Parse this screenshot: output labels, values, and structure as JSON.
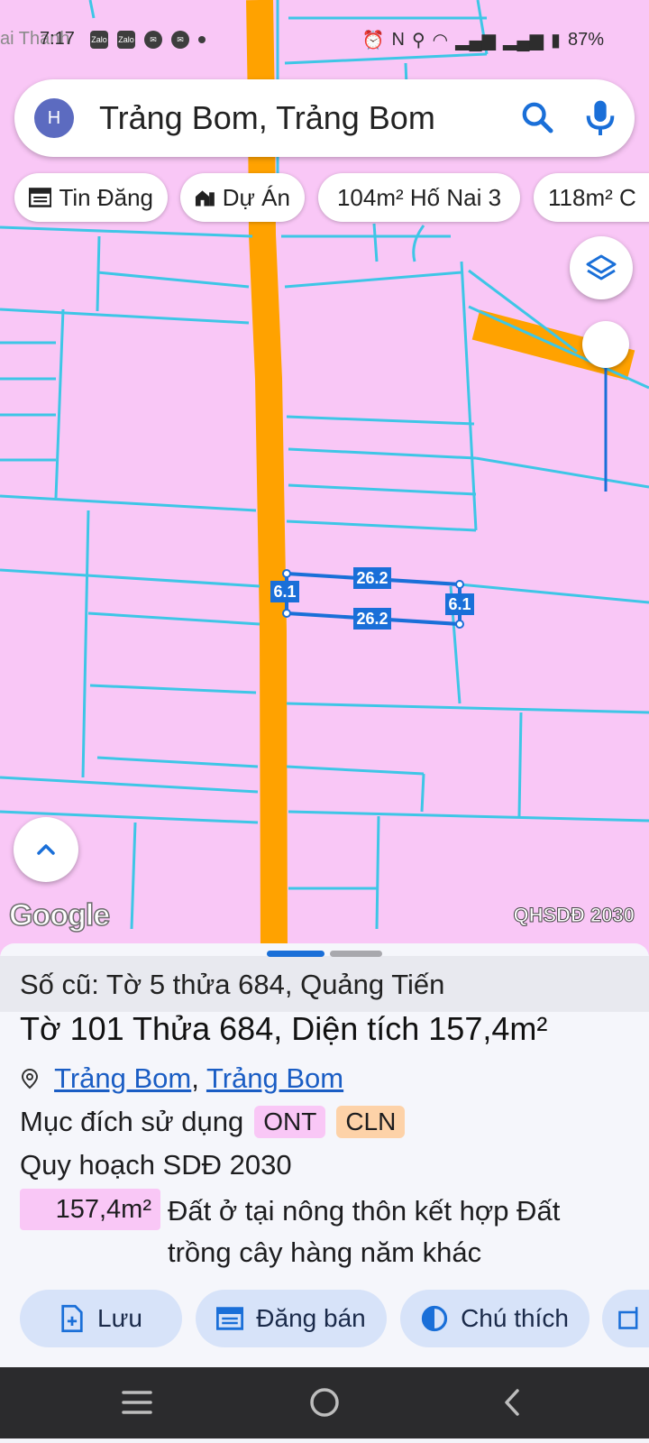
{
  "status_bar": {
    "time": "7:17",
    "battery": "87%",
    "ghost_text": "ai Thanh"
  },
  "search": {
    "avatar_letter": "H",
    "query": "Trảng Bom, Trảng Bom"
  },
  "chips": [
    {
      "label": "Tin Đăng",
      "icon": "calendar-list-icon"
    },
    {
      "label": "Dự Án",
      "icon": "house-icon"
    },
    {
      "label": "104m² Hố Nai 3"
    },
    {
      "label": "118m² C"
    }
  ],
  "map": {
    "parcel_lengths": {
      "top": "26.2",
      "bottom": "26.2",
      "left": "6.1",
      "right": "6.1"
    },
    "google_logo": "Google",
    "overlay_label": "QHSDĐ 2030",
    "colors": {
      "land": "#f9c7f6",
      "road": "#ffa200",
      "boundary": "#3ec6e6",
      "parcel": "#1a6fd8"
    }
  },
  "sheet": {
    "old_info": "Số cũ: Tờ 5 thửa 684, Quảng Tiến",
    "title": "Tờ 101 Thửa 684, Diện tích 157,4m²",
    "location": {
      "district": "Trảng Bom",
      "commune": "Trảng Bom",
      "separator": ","
    },
    "purpose_label": "Mục đích sử dụng",
    "purpose_tags": [
      {
        "code": "ONT",
        "color": "#f9c7f6"
      },
      {
        "code": "CLN",
        "color": "#fdd2a8"
      }
    ],
    "plan_label": "Quy hoạch SDĐ 2030",
    "area_value": "157,4m²",
    "area_description": "Đất ở tại nông thôn kết hợp Đất trồng cây hàng năm khác"
  },
  "actions": [
    {
      "label": "Lưu",
      "icon": "file-add-icon"
    },
    {
      "label": "Đăng bán",
      "icon": "calendar-list-icon"
    },
    {
      "label": "Chú thích",
      "icon": "contrast-icon"
    }
  ]
}
